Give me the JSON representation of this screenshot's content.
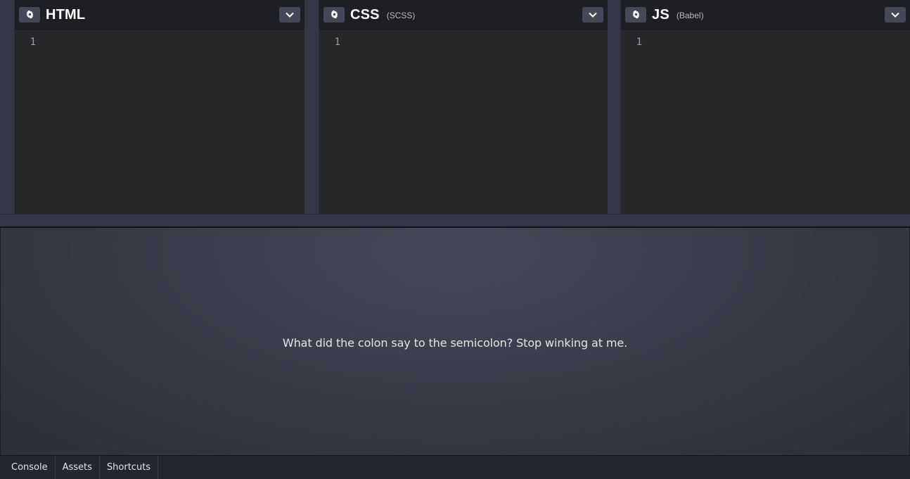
{
  "editors": [
    {
      "title": "HTML",
      "subtitle": "",
      "line_number": "1"
    },
    {
      "title": "CSS",
      "subtitle": "(SCSS)",
      "line_number": "1"
    },
    {
      "title": "JS",
      "subtitle": "(Babel)",
      "line_number": "1"
    }
  ],
  "icons": {
    "settings": "gear-icon",
    "collapse": "chevron-down-icon"
  },
  "preview": {
    "text": "What did the colon say to the semicolon? Stop winking at me."
  },
  "footer": {
    "tabs": [
      "Console",
      "Assets",
      "Shortcuts"
    ]
  },
  "colors": {
    "editor_background": "#262729",
    "header_background": "#1e1f23",
    "button_background": "#444857",
    "chrome": "#343746"
  }
}
